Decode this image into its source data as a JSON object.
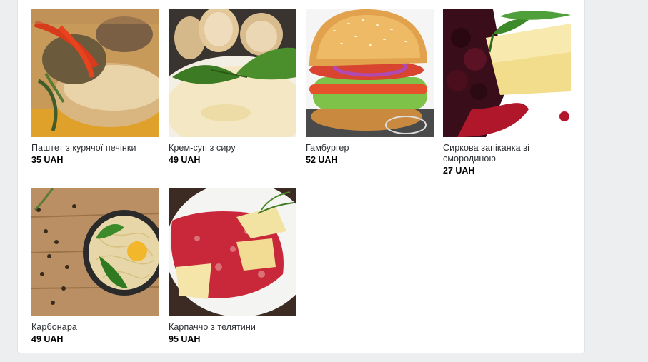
{
  "products": [
    {
      "name": "Паштет з курячої печінки",
      "price": "35 UAH",
      "image": "pate-dish-photo"
    },
    {
      "name": "Крем-суп з сиру",
      "price": "49 UAH",
      "image": "cheese-cream-soup-photo"
    },
    {
      "name": "Гамбургер",
      "price": "52 UAH",
      "image": "hamburger-photo"
    },
    {
      "name": "Сиркова запіканка зі смородиною",
      "price": "27 UAH",
      "image": "curd-casserole-photo"
    },
    {
      "name": "Карбонара",
      "price": "49 UAH",
      "image": "carbonara-photo"
    },
    {
      "name": "Карпаччо з телятини",
      "price": "95 UAH",
      "image": "veal-carpaccio-photo"
    }
  ],
  "colors": {
    "page_bg": "#edeef0",
    "panel_bg": "#ffffff",
    "text": "#2b2f33",
    "price": "#000000"
  }
}
